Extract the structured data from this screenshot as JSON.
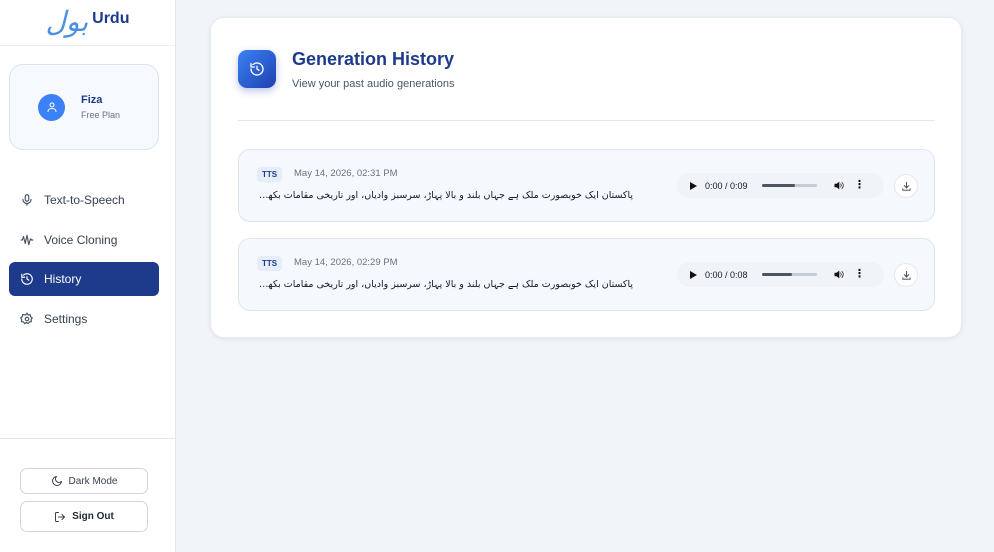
{
  "app": {
    "logo_mark": "بول",
    "logo_text": "Urdu"
  },
  "user": {
    "name": "Fiza",
    "plan": "Free Plan"
  },
  "nav": {
    "items": [
      {
        "label": "Text-to-Speech",
        "icon": "microphone-icon"
      },
      {
        "label": "Voice Cloning",
        "icon": "waveform-icon"
      },
      {
        "label": "History",
        "icon": "history-icon",
        "active": true
      },
      {
        "label": "Settings",
        "icon": "gear-icon"
      }
    ]
  },
  "footer": {
    "dark_mode_label": "Dark Mode",
    "sign_out_label": "Sign Out"
  },
  "page": {
    "title": "Generation History",
    "subtitle": "View your past audio generations"
  },
  "history": [
    {
      "type": "TTS",
      "timestamp": "May 14, 2026, 02:31 PM",
      "text": "پاکستان ایک خوبصورت ملک ہے جہاں بلند و بالا پہاڑ، سرسبز وادیاں، اور تاریخی مقامات بکھرے ہوئے ہیں",
      "audio_time": "0:00 / 0:09",
      "progress": 0.6
    },
    {
      "type": "TTS",
      "timestamp": "May 14, 2026, 02:29 PM",
      "text": "پاکستان ایک خوبصورت ملک ہے جہاں بلند و بالا پہاڑ، سرسبز وادیاں، اور تاریخی مقامات بکھرے ہوئے ہیں",
      "audio_time": "0:00 / 0:08",
      "progress": 0.55
    }
  ],
  "colors": {
    "primary": "#1e3a8a",
    "accent": "#3b82f6",
    "background": "#f1f4f8"
  }
}
